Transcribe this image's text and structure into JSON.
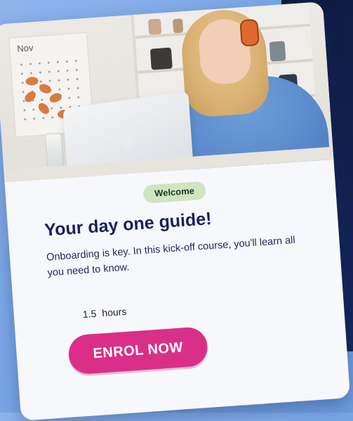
{
  "card": {
    "photo": {
      "calendar_month": "Nov",
      "icons": [
        "laptop-icon",
        "headphones-icon"
      ]
    },
    "badge": "Welcome",
    "title": "Your day one guide!",
    "description": "Onboarding is key. In this kick-off course, you'll learn all you need to know.",
    "duration": {
      "value": "1.5",
      "unit": "hours"
    },
    "enrol_button": "ENROL NOW"
  },
  "colors": {
    "title": "#1c1f5c",
    "badge_bg": "#cfe5c1",
    "button_bg": "#da2f89",
    "background": "#7aa6e6",
    "panel": "#0f1d44"
  }
}
